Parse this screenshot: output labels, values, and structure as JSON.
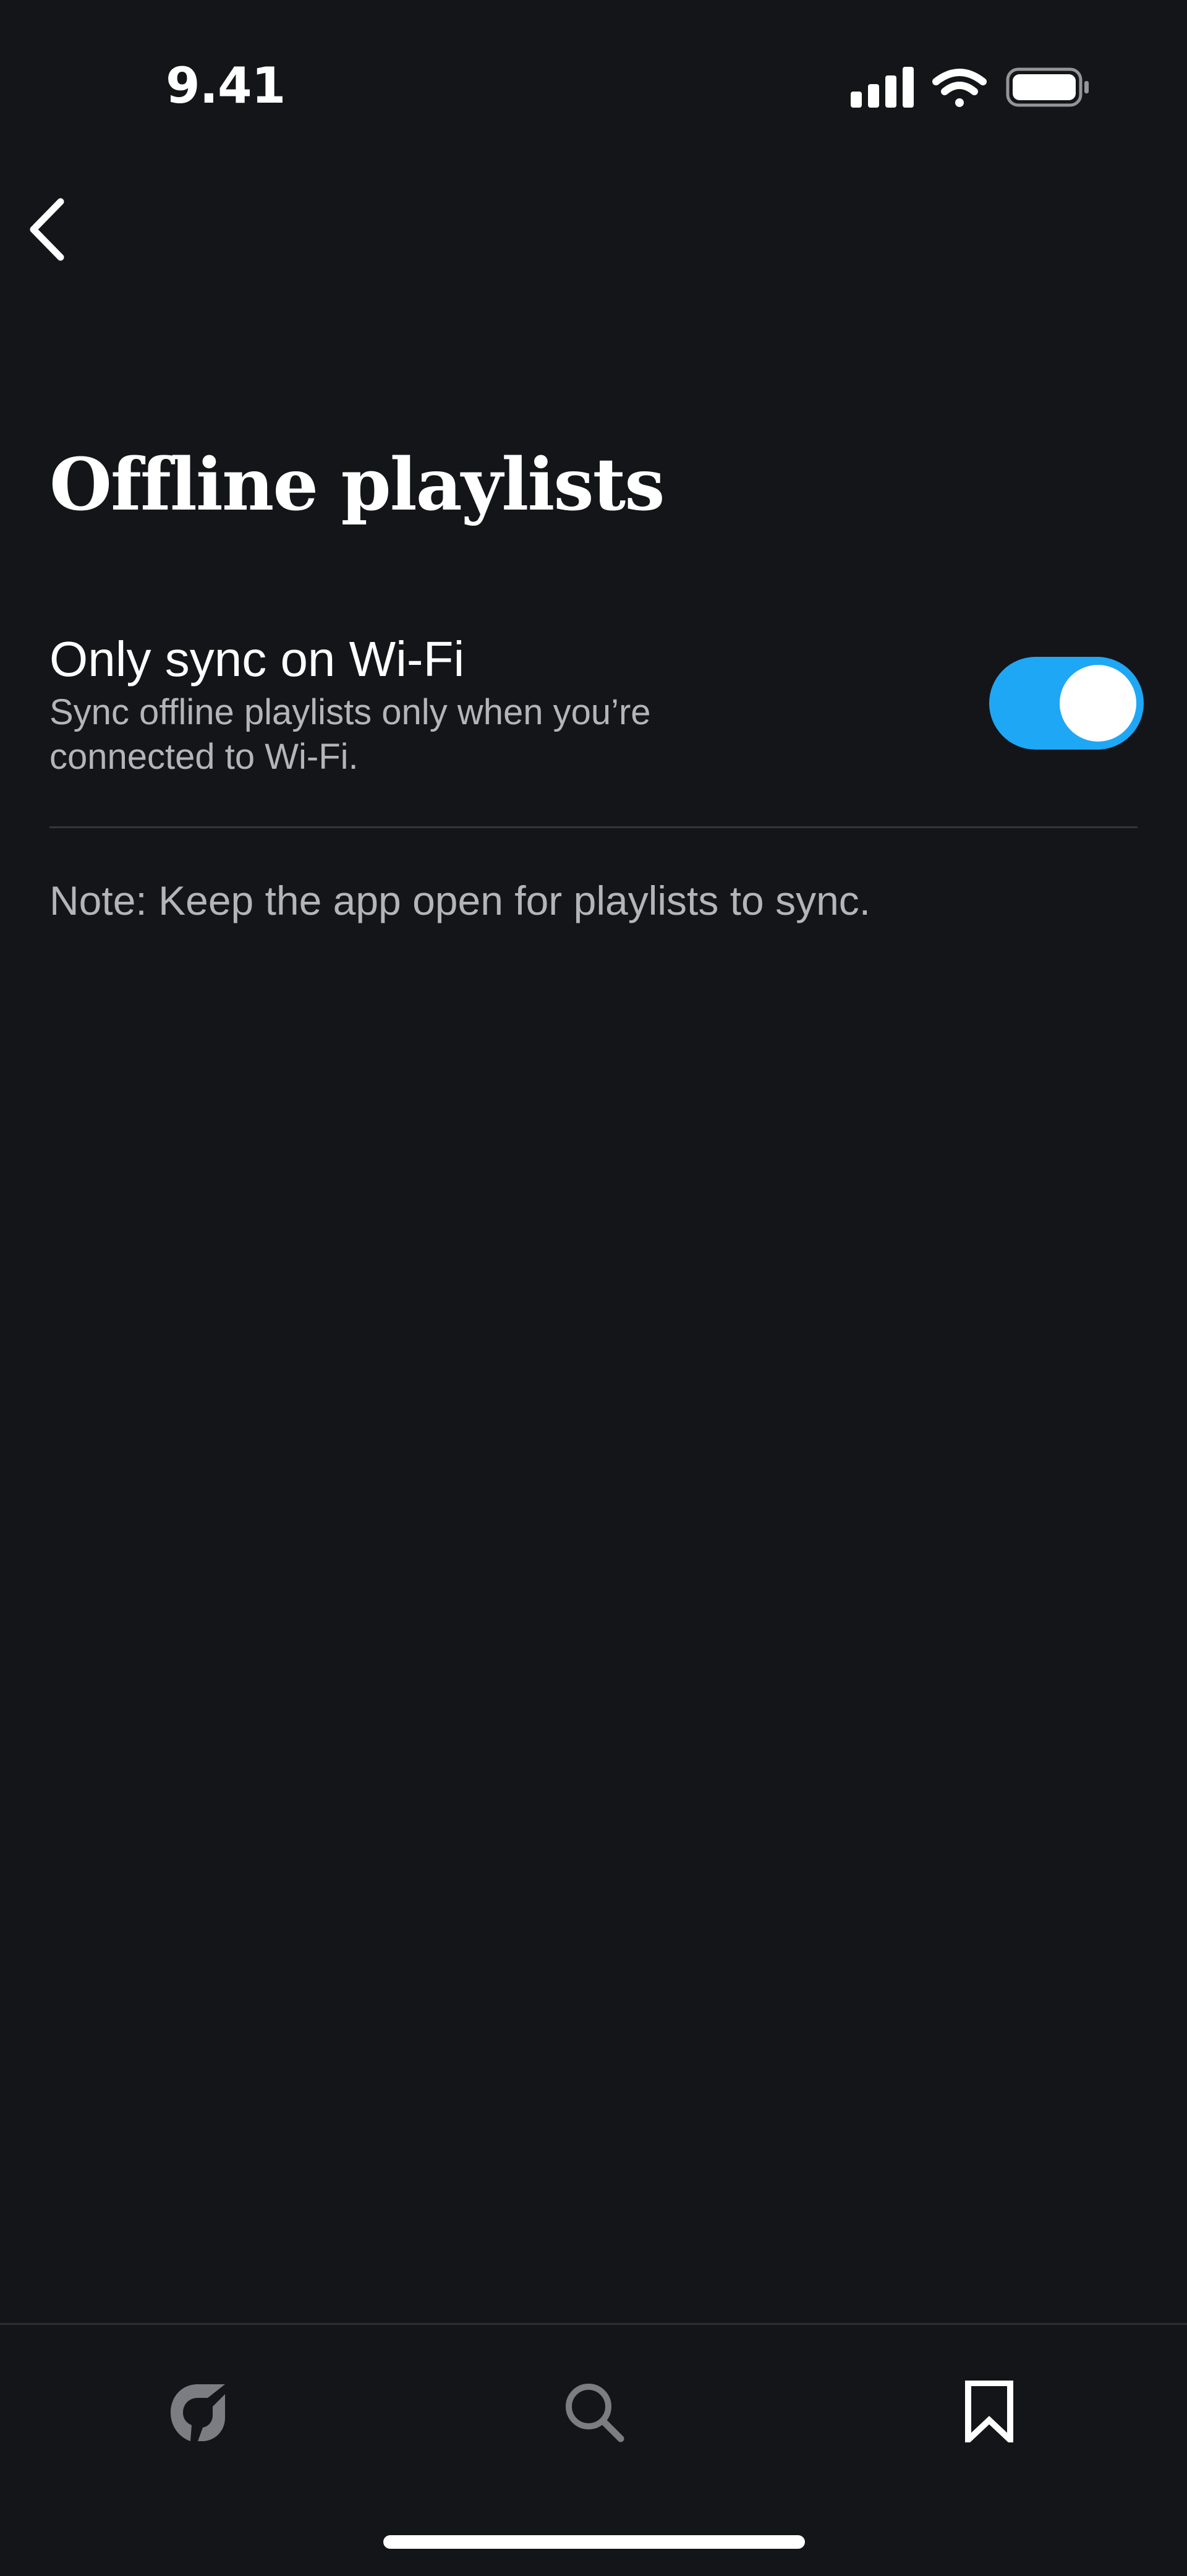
{
  "status_bar": {
    "time": "9.41",
    "icons": [
      "cellular-signal-icon",
      "wifi-icon",
      "battery-icon"
    ]
  },
  "header": {
    "back_icon": "chevron-left-icon"
  },
  "page": {
    "title": "Offline playlists"
  },
  "settings": {
    "wifi_sync": {
      "title": "Only sync on Wi-Fi",
      "description": "Sync offline playlists only when you’re connected to Wi-Fi.",
      "enabled": true
    }
  },
  "note": "Note: Keep the app open for playlists to sync.",
  "tab_bar": {
    "tabs": [
      {
        "icon": "home-logo-icon",
        "active": false
      },
      {
        "icon": "search-icon",
        "active": false
      },
      {
        "icon": "bookmark-icon",
        "active": true
      }
    ]
  },
  "colors": {
    "background": "#141519",
    "accent": "#1ea7f5",
    "text_primary": "#ffffff",
    "text_secondary": "#b3b5bb",
    "divider": "#34363b"
  }
}
